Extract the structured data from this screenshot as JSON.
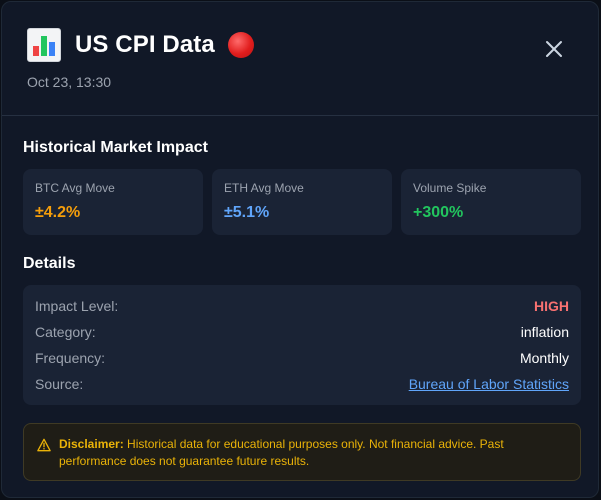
{
  "header": {
    "icon": "bar-chart-emoji",
    "title": "US CPI Data",
    "status_icon": "red-circle",
    "date": "Oct 23, 13:30",
    "close_icon": "close-icon"
  },
  "historical": {
    "title": "Historical Market Impact",
    "cards": [
      {
        "label": "BTC Avg Move",
        "value": "±4.2%",
        "color": "#f59e0b"
      },
      {
        "label": "ETH Avg Move",
        "value": "±5.1%",
        "color": "#60a5fa"
      },
      {
        "label": "Volume Spike",
        "value": "+300%",
        "color": "#22c55e"
      }
    ]
  },
  "details": {
    "title": "Details",
    "rows": [
      {
        "label": "Impact Level:",
        "value": "HIGH",
        "color": "#f87171"
      },
      {
        "label": "Category:",
        "value": "inflation",
        "color": "#ffffff"
      },
      {
        "label": "Frequency:",
        "value": "Monthly",
        "color": "#ffffff"
      },
      {
        "label": "Source:",
        "value": "Bureau of Labor Statistics",
        "color": "#60a5fa"
      }
    ]
  },
  "disclaimer": {
    "icon": "warning-icon",
    "label": "Disclaimer:",
    "text": "Historical data for educational purposes only. Not financial advice. Past performance does not guarantee future results."
  }
}
